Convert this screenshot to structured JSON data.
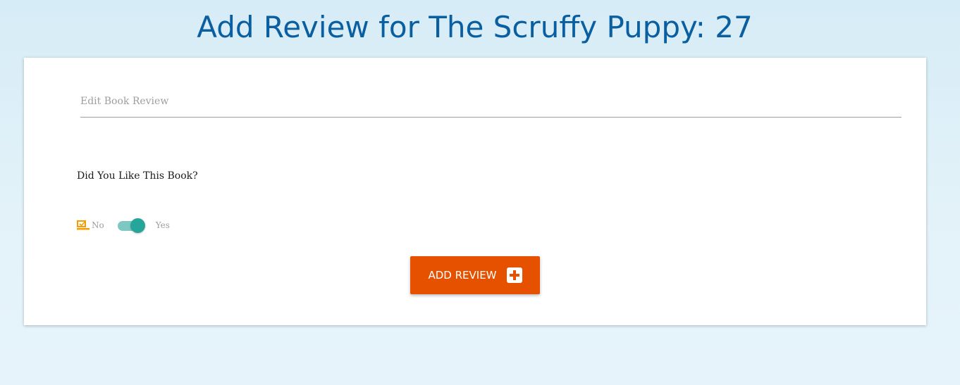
{
  "page": {
    "title": "Add Review for The Scruffy Puppy: 27"
  },
  "review": {
    "placeholder": "Edit Book Review",
    "value": ""
  },
  "question": {
    "label": "Did You Like This Book?"
  },
  "liked_toggle": {
    "off_label": "No",
    "on_label": "Yes",
    "checked": true
  },
  "add_button": {
    "label": "ADD REVIEW",
    "icon": "plus-square-icon"
  },
  "colors": {
    "title": "#0a5fa0",
    "button": "#e65100",
    "toggle_on": "#26a69a",
    "checkbox_icon": "#f59c00"
  }
}
